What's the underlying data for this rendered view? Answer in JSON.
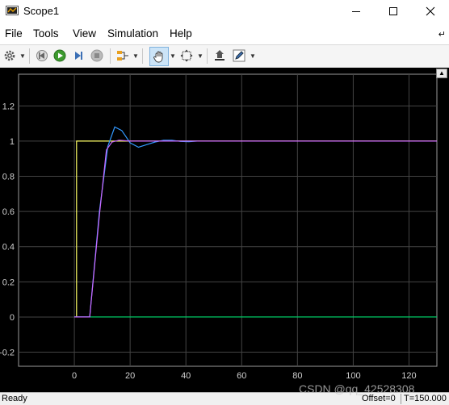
{
  "window": {
    "title": "Scope1"
  },
  "menu": {
    "items": [
      "File",
      "Tools",
      "View",
      "Simulation",
      "Help"
    ]
  },
  "toolbar": {
    "icons": [
      "gear-icon",
      "step-back-icon",
      "run-icon",
      "step-forward-icon",
      "stop-icon",
      "signal-selector-icon",
      "pan-hand-icon",
      "zoom-fit-icon",
      "highlight-icon",
      "style-pen-icon"
    ],
    "active": "pan-hand-icon"
  },
  "chart_data": {
    "type": "line",
    "xlim": [
      -20,
      130
    ],
    "ylim": [
      -0.28,
      1.38
    ],
    "xticks": [
      0,
      20,
      40,
      60,
      80,
      100,
      120
    ],
    "yticks": [
      -0.2,
      0,
      0.2,
      0.4,
      0.6,
      0.8,
      1,
      1.2
    ],
    "ytick_labels": [
      "-0.2",
      "0",
      "0.2",
      "0.4",
      "0.6",
      "0.8",
      "1",
      "1.2"
    ],
    "grid": true,
    "series": [
      {
        "color": "#ffff66",
        "x": [
          0,
          0.8,
          0.8,
          130
        ],
        "y": [
          0,
          0,
          1,
          1
        ]
      },
      {
        "color": "#00cc66",
        "x": [
          0,
          130
        ],
        "y": [
          0,
          0
        ]
      },
      {
        "color": "#3399ff",
        "x": [
          0,
          5.5,
          9,
          12,
          14.5,
          17,
          20,
          23,
          26,
          29,
          32,
          35,
          38,
          41,
          44
        ],
        "y": [
          0,
          0,
          0.6,
          0.97,
          1.08,
          1.06,
          0.99,
          0.965,
          0.98,
          0.995,
          1.005,
          1.005,
          0.998,
          0.996,
          1.0
        ]
      },
      {
        "color": "#cc66ff",
        "x": [
          0,
          5.5,
          9,
          11.5,
          13.5,
          16,
          20,
          25,
          30,
          35,
          40,
          130
        ],
        "y": [
          0,
          0,
          0.58,
          0.95,
          0.995,
          1.005,
          1.0,
          1.0,
          1.0,
          1.0,
          1.0,
          1.0
        ]
      }
    ]
  },
  "status": {
    "ready": "Ready",
    "offset": "Offset=0",
    "time": "T=150.000"
  },
  "watermark": "CSDN @qq_42528308"
}
